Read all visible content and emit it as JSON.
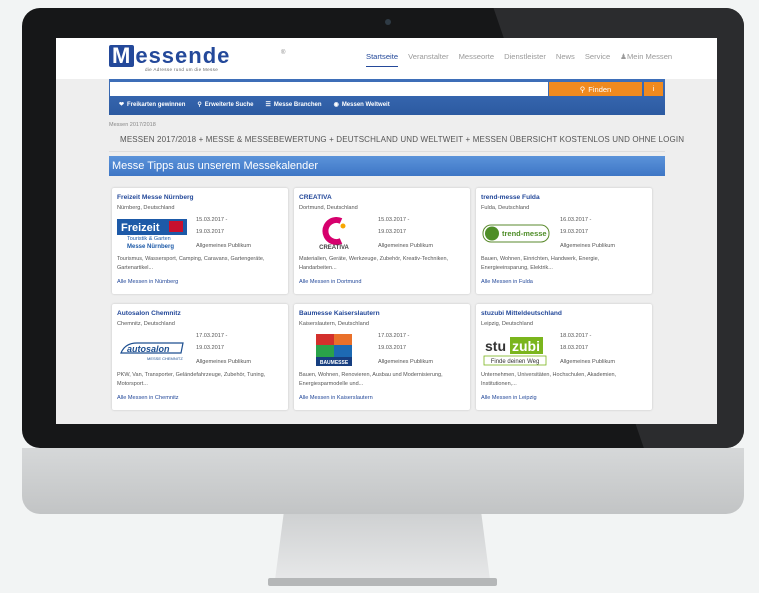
{
  "site": {
    "logo_text": "essende",
    "logo_m": "M",
    "logo_reg": "®",
    "logo_tagline": "die Adresse rund um die Messe"
  },
  "nav": {
    "items": [
      "Startseite",
      "Veranstalter",
      "Messeorte",
      "Dienstleister",
      "News",
      "Service",
      "Mein Messen"
    ]
  },
  "search": {
    "placeholder": "",
    "button_label": "Finden",
    "info_label": "i",
    "subnav": [
      "Freikarten gewinnen",
      "Erweiterte Suche",
      "Messe Branchen",
      "Messen Weltweit"
    ]
  },
  "breadcrumb": "Messen 2017/2018",
  "page_title": "MESSEN 2017/2018 + MESSE & MESSEBEWERTUNG + DEUTSCHLAND UND WELTWEIT + MESSEN ÜBERSICHT KOSTENLOS UND OHNE LOGIN",
  "section_title": "Messe Tipps aus unserem Messekalender",
  "cards": [
    {
      "title": "Freizeit Messe Nürnberg",
      "location": "Nürnberg, Deutschland",
      "date_from": "15.03.2017 -",
      "date_to": "19.03.2017",
      "audience": "Allgemeines Publikum",
      "description": "Tourismus, Wassersport, Camping, Caravans, Gartengeräte, Gartenartikel...",
      "link": "Alle Messen in Nürnberg",
      "logo": {
        "line1": "Freizeit",
        "line2": "Touristik & Garten",
        "line3": "Messe Nürnberg"
      }
    },
    {
      "title": "CREATIVA",
      "location": "Dortmund, Deutschland",
      "date_from": "15.03.2017 -",
      "date_to": "19.03.2017",
      "audience": "Allgemeines Publikum",
      "description": "Materialien, Geräte, Werkzeuge, Zubehör, Kreativ-Techniken, Handarbeiten...",
      "link": "Alle Messen in Dortmund",
      "logo": {
        "line1": "CREATIVA"
      }
    },
    {
      "title": "trend-messe Fulda",
      "location": "Fulda, Deutschland",
      "date_from": "16.03.2017 -",
      "date_to": "19.03.2017",
      "audience": "Allgemeines Publikum",
      "description": "Bauen, Wohnen, Einrichten, Handwerk, Energie, Energieeinsparung, Elektrik...",
      "link": "Alle Messen in Fulda",
      "logo": {
        "line1": "trend-messe"
      }
    },
    {
      "title": "Autosalon Chemnitz",
      "location": "Chemnitz, Deutschland",
      "date_from": "17.03.2017 -",
      "date_to": "19.03.2017",
      "audience": "Allgemeines Publikum",
      "description": "PKW, Van, Transporter, Geländefahrzeuge, Zubehör, Tuning, Motorsport...",
      "link": "Alle Messen in Chemnitz",
      "logo": {
        "line1": "autosalon",
        "line2": "MESSE CHEMNITZ"
      }
    },
    {
      "title": "Baumesse Kaiserslautern",
      "location": "Kaiserslautern, Deutschland",
      "date_from": "17.03.2017 -",
      "date_to": "19.03.2017",
      "audience": "Allgemeines Publikum",
      "description": "Bauen, Wohnen, Renovieren, Ausbau und Modernisierung, Energiesparmodelle und...",
      "link": "Alle Messen in Kaiserslautern",
      "logo": {
        "line1": "BAUMESSE"
      }
    },
    {
      "title": "stuzubi Mitteldeutschland",
      "location": "Leipzig, Deutschland",
      "date_from": "18.03.2017 -",
      "date_to": "18.03.2017",
      "audience": "Allgemeines Publikum",
      "description": "Unternehmen, Universitäten, Hochschulen, Akademien, Institutionen,...",
      "link": "Alle Messen in Leipzig",
      "logo": {
        "line1": "stu",
        "line2": "zubi",
        "line3": "Finde deinen Weg"
      }
    }
  ],
  "colors": {
    "brand_blue": "#24499a",
    "search_bar": "#2c5aa1",
    "button_orange": "#f08a1f",
    "tips_bar": "#4a82cf"
  }
}
